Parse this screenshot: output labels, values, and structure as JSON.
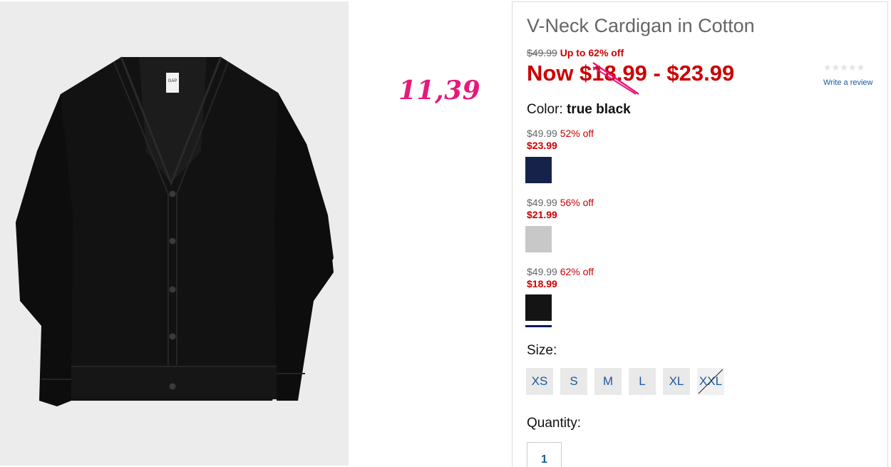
{
  "product": {
    "title": "V-Neck Cardigan in Cotton",
    "original_price": "$49.99",
    "discount_text": "Up to 62% off",
    "now_price": "Now $18.99 - $23.99",
    "rating": {
      "stars": "★★★★★",
      "link": "Write a review",
      "value": 0
    },
    "color_label": "Color:",
    "color_value": "true black"
  },
  "annotation": "11,39",
  "variants": [
    {
      "original": "$49.99",
      "discount": "52% off",
      "sale": "$23.99",
      "swatch": "navy",
      "color": "#16224a"
    },
    {
      "original": "$49.99",
      "discount": "56% off",
      "sale": "$21.99",
      "swatch": "heather grey",
      "color": "#c8c8c8"
    },
    {
      "original": "$49.99",
      "discount": "62% off",
      "sale": "$18.99",
      "swatch": "true black",
      "color": "#141414",
      "selected": true
    }
  ],
  "size": {
    "label": "Size:",
    "options": [
      "XS",
      "S",
      "M",
      "L",
      "XL",
      "XXL"
    ],
    "unavailable": [
      "XXL"
    ]
  },
  "quantity": {
    "label": "Quantity:",
    "value": "1"
  },
  "colors": {
    "sale_red": "#cc0000",
    "link_blue": "#1a5a9a",
    "annotation_pink": "#e8187a"
  }
}
